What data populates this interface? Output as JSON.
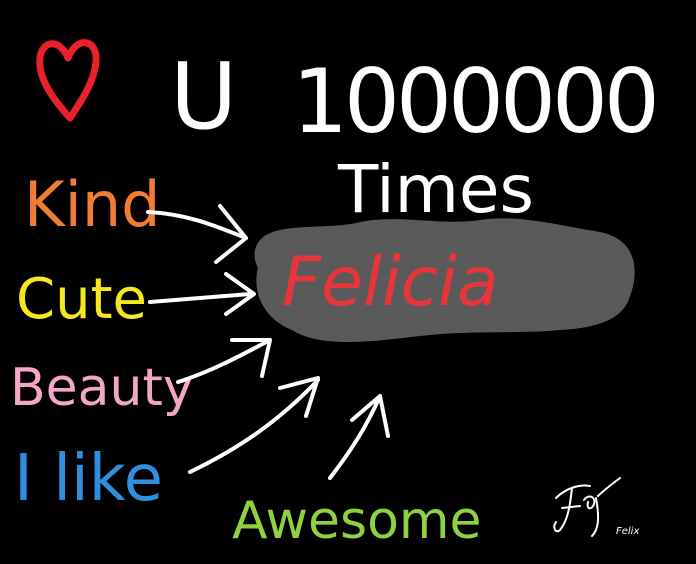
{
  "canvas": {
    "background": "#000000"
  },
  "headline": {
    "heart_icon": "heart-icon",
    "heart_color": "#e8212b",
    "u": "U",
    "count": "1000000",
    "times": "Times",
    "color": "#ffffff"
  },
  "center": {
    "name": "Felicia",
    "name_color": "#e8353a",
    "cloud_color": "#5a5a5a"
  },
  "words": [
    {
      "text": "Kind",
      "color": "#f07d33"
    },
    {
      "text": "Cute",
      "color": "#f5e81c"
    },
    {
      "text": "Beauty",
      "color": "#f4a6c6"
    },
    {
      "text": "I like",
      "color": "#2f8ee0"
    },
    {
      "text": "Awesome",
      "color": "#8fd13f"
    }
  ],
  "arrows": {
    "color": "#ffffff"
  },
  "signature": {
    "scribble_icon": "signature-scribble",
    "name": "Felix",
    "color": "#ffffff"
  }
}
